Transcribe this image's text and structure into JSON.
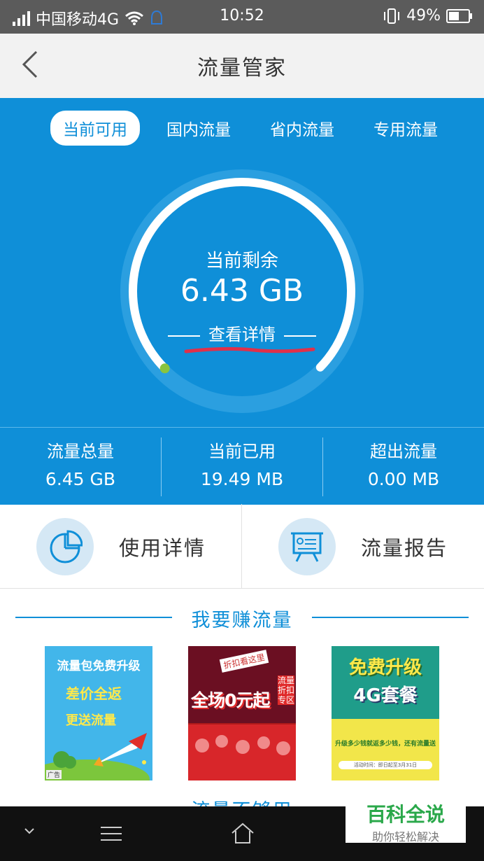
{
  "status_bar": {
    "carrier": "中国移动4G",
    "time": "10:52",
    "battery": "49%"
  },
  "header": {
    "title": "流量管家"
  },
  "tabs": [
    {
      "label": "当前可用",
      "active": true
    },
    {
      "label": "国内流量",
      "active": false
    },
    {
      "label": "省内流量",
      "active": false
    },
    {
      "label": "专用流量",
      "active": false
    }
  ],
  "gauge": {
    "label": "当前剩余",
    "value": "6.43 GB",
    "detail_link": "查看详情",
    "remaining_fraction": 0.997
  },
  "stats": [
    {
      "label": "流量总量",
      "value": "6.45 GB"
    },
    {
      "label": "当前已用",
      "value": "19.49 MB"
    },
    {
      "label": "超出流量",
      "value": "0.00 MB"
    }
  ],
  "actions": [
    {
      "label": "使用详情",
      "icon": "pie-chart-icon"
    },
    {
      "label": "流量报告",
      "icon": "report-board-icon"
    }
  ],
  "earn_section": {
    "title": "我要赚流量",
    "promos": [
      {
        "line1": "流量包免费升级",
        "line2": "差价全返",
        "line3": "更送流量",
        "ad_tag": "广告"
      },
      {
        "tag": "折扣看这里",
        "headline": "全场0元起",
        "side": "流量折扣专区"
      },
      {
        "headline1": "免费升级",
        "headline2": "4G套餐",
        "sub": "升级多少钱就返多少钱，还有流量送",
        "note": "活动时间：即日起至3月31日"
      }
    ]
  },
  "next_section": {
    "title": "流量不够用"
  },
  "watermark": {
    "title": "百科全说",
    "subtitle": "助你轻松解决"
  },
  "colors": {
    "primary": "#0f8fd8",
    "accent_green": "#8ac43f",
    "annotation_red": "#e0304a"
  }
}
